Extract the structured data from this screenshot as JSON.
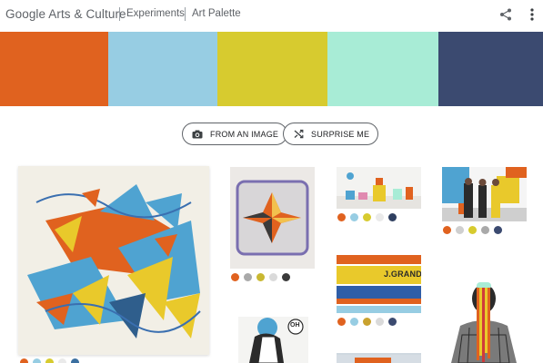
{
  "header": {
    "brand": "Google Arts & Culture",
    "crumbs": [
      "Experiments",
      "Art Palette"
    ],
    "share_icon": "share-icon",
    "menu_icon": "more-vert-icon"
  },
  "palette": {
    "colors": [
      "#E0621F",
      "#97CDE3",
      "#D7CB2F",
      "#A8ECD6",
      "#3B4A70"
    ]
  },
  "actions": {
    "from_image_label": "FROM AN IMAGE",
    "from_image_icon": "camera-icon",
    "surprise_label": "SURPRISE ME",
    "surprise_icon": "shuffle-icon"
  },
  "gallery": [
    {
      "name": "abstract-mural",
      "palette": [
        "#E0621F",
        "#97CDE3",
        "#D7CB2F",
        "#EAEAEA",
        "#3B6FA0"
      ]
    },
    {
      "name": "folded-star",
      "palette": [
        "#E0621F",
        "#A9A9A9",
        "#C9B832",
        "#DADADA",
        "#3A3A3A"
      ]
    },
    {
      "name": "comic-figure",
      "palette": []
    },
    {
      "name": "gift-sculptures",
      "palette": [
        "#E0621F",
        "#97CDE3",
        "#D7CB2F",
        "#EAEAEA",
        "#2F3F60"
      ]
    },
    {
      "name": "painted-wall-jgranda",
      "palette": [
        "#E0621F",
        "#97CDE3",
        "#C9A22F",
        "#DADADA",
        "#3B4A70"
      ]
    },
    {
      "name": "gallery-people",
      "palette": [
        "#E0621F",
        "#CFCFCF",
        "#D7CB2F",
        "#A9A9A9",
        "#3B4A70"
      ]
    },
    {
      "name": "dripping-portrait",
      "palette": []
    }
  ],
  "tile_text": {
    "wall_sign": "J.GRANDA",
    "badge": "OH"
  }
}
